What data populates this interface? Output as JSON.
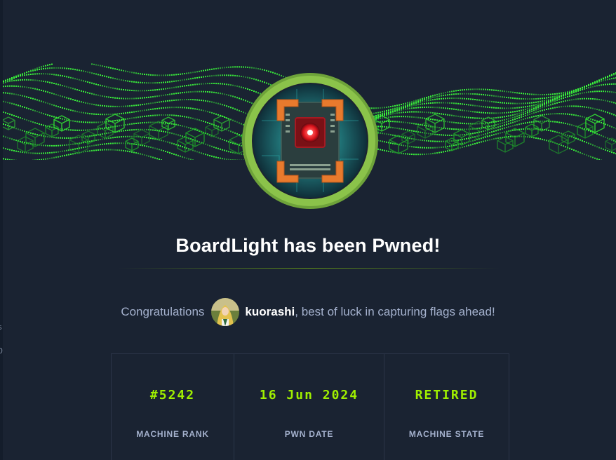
{
  "machine": {
    "name": "BoardLight",
    "badge_icon": "circuit-board-icon"
  },
  "title": "BoardLight has been Pwned!",
  "congrats": {
    "prefix": "Congratulations",
    "username": "kuorashi",
    "suffix": ", best of luck in capturing flags ahead!"
  },
  "stats": [
    {
      "value": "#5242",
      "label": "MACHINE RANK"
    },
    {
      "value": "16 Jun 2024",
      "label": "PWN DATE"
    },
    {
      "value": "RETIRED",
      "label": "MACHINE STATE"
    }
  ],
  "colors": {
    "accent": "#9fef00",
    "background": "#1a2332",
    "text_muted": "#a4b1cd",
    "badge_ring": "#8bc34a",
    "badge_corner": "#e87a2d",
    "badge_core": "#ff2a2a"
  },
  "edge_glyphs": [
    "s",
    "0"
  ]
}
